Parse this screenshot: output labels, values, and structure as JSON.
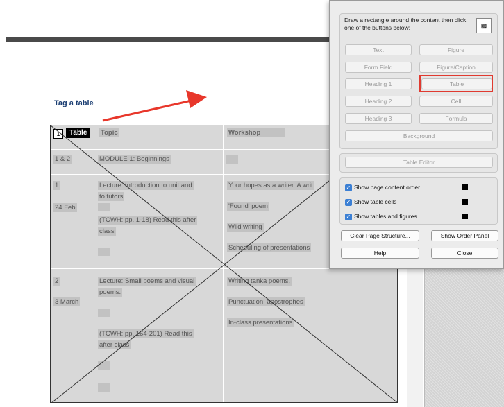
{
  "document": {
    "heading": "Tag a table",
    "tag_label": "Table",
    "tag_box_char": "1",
    "table": {
      "headers": [
        "Topic",
        "Workshop"
      ],
      "rows": [
        {
          "week": "1 & 2",
          "topic": [
            "MODULE 1: Beginnings"
          ],
          "workshop": [
            ""
          ]
        },
        {
          "week": "1",
          "date": "24 Feb",
          "topic": [
            "Lecture: Introduction to unit and",
            "to tutors",
            "(TCWH: pp. 1-18) Read this after",
            "class"
          ],
          "workshop": [
            "Your hopes as a writer. A writ",
            "'Found' poem",
            "Wild writing",
            "Scheduling of presentations"
          ]
        },
        {
          "week": "2",
          "date": "3 March",
          "topic": [
            "Lecture:  Small poems and visual",
            "poems.",
            "(TCWH: pp. 164-201) Read this",
            "after class"
          ],
          "workshop": [
            "Writing tanka poems.",
            "Punctuation: apostrophes",
            "In-class presentations"
          ]
        }
      ]
    }
  },
  "panel": {
    "instructions": "Draw a rectangle around the content then click one of the buttons below:",
    "buttons": {
      "text": "Text",
      "figure": "Figure",
      "form_field": "Form Field",
      "figure_caption": "Figure/Caption",
      "heading1": "Heading 1",
      "table": "Table",
      "heading2": "Heading 2",
      "cell": "Cell",
      "heading3": "Heading 3",
      "formula": "Formula",
      "background": "Background",
      "table_editor": "Table Editor"
    },
    "checkboxes": [
      {
        "label": "Show page content order",
        "checked": true
      },
      {
        "label": "Show table cells",
        "checked": true
      },
      {
        "label": "Show tables and figures",
        "checked": true
      }
    ],
    "clear_page_structure": "Clear Page Structure...",
    "show_order_panel": "Show Order Panel",
    "help": "Help",
    "close": "Close"
  },
  "colors": {
    "highlight": "#e03a30",
    "heading": "#1c3f73",
    "checkbox": "#3b7fd4"
  }
}
